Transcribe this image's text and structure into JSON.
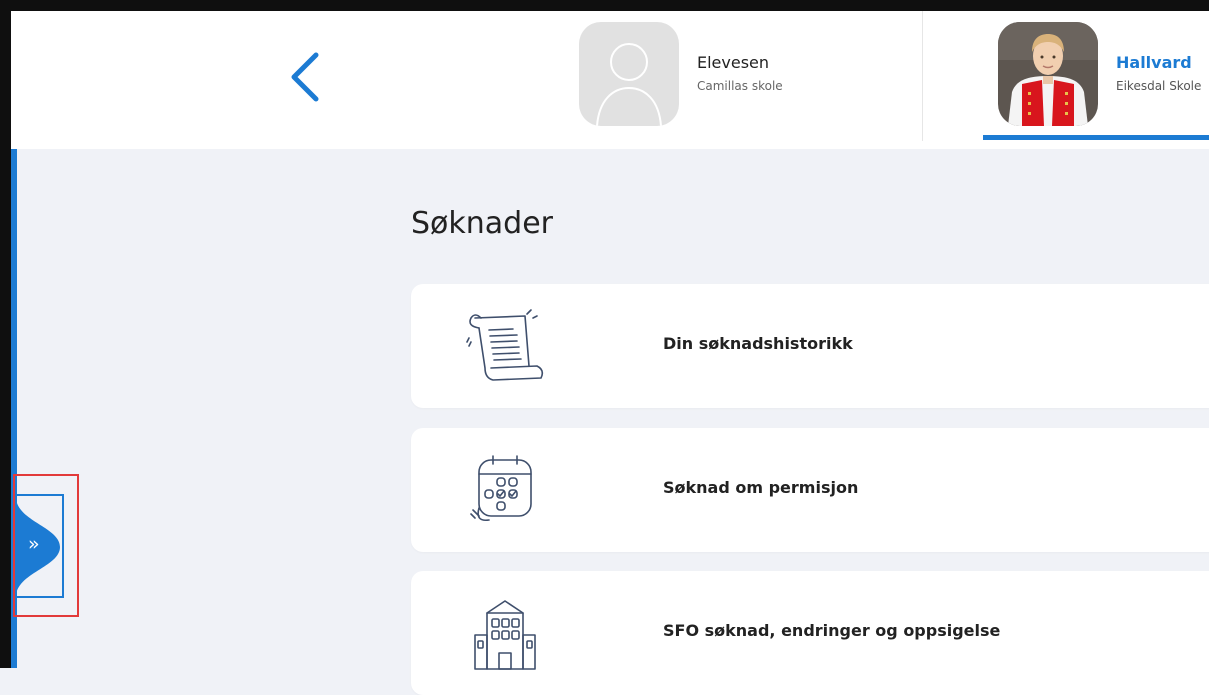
{
  "header": {
    "back_label": "Tilbake",
    "profiles": [
      {
        "name": "Elevesen",
        "school": "Camillas skole",
        "active": false
      },
      {
        "name": "Hallvard",
        "school": "Eikesdal Skole",
        "active": true
      }
    ]
  },
  "sidebar": {
    "toggle_glyph": "»"
  },
  "main": {
    "title": "Søknader",
    "cards": [
      {
        "label": "Din søknadshistorikk",
        "icon": "scroll-document-icon"
      },
      {
        "label": "Søknad om permisjon",
        "icon": "calendar-checklist-icon"
      },
      {
        "label": "SFO søknad, endringer og oppsigelse",
        "icon": "school-building-icon"
      }
    ]
  },
  "colors": {
    "accent": "#1c7bd3",
    "background": "#f0f2f7",
    "card": "#ffffff",
    "highlight": "#e23a3a"
  }
}
